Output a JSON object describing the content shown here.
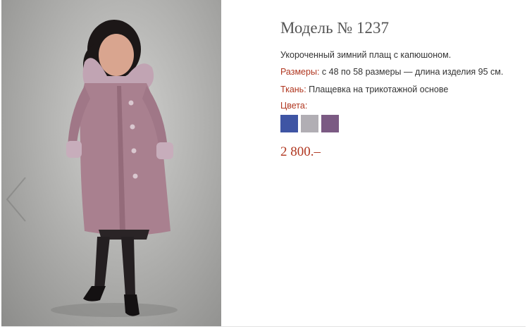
{
  "product": {
    "title": "Модель № 1237",
    "description": "Укороченный зимний плащ с капюшоном.",
    "sizes_label": "Размеры:",
    "sizes_value": " с 48 по 58 размеры — длина изделия 95 см.",
    "fabric_label": "Ткань:",
    "fabric_value": " Плащевка на трикотажной основе",
    "colors_label": "Цвета:",
    "colors": [
      {
        "name": "blue",
        "hex": "#3f55a4"
      },
      {
        "name": "light-grey",
        "hex": "#b1aeb4"
      },
      {
        "name": "purple",
        "hex": "#7b5a83"
      }
    ],
    "price": "2 800.–"
  },
  "photo": {
    "subject": "product-photo",
    "coat_color": "#a9808f"
  },
  "gallery": {
    "prev_icon": "chevron-left-icon"
  },
  "theme": {
    "accent": "#b0361f",
    "text": "#333333",
    "title": "#555555"
  }
}
